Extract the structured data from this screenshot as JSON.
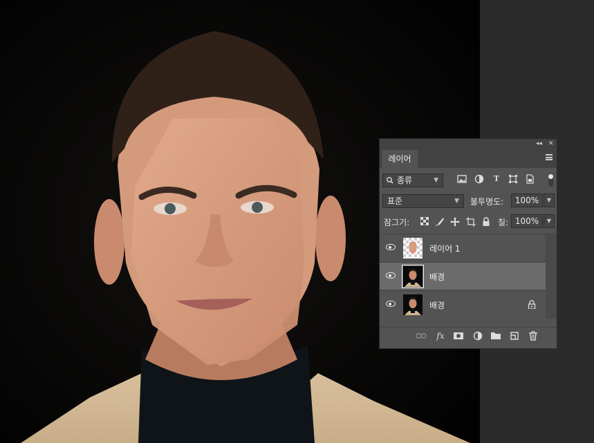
{
  "panel": {
    "collapse_label": "◂◂",
    "close_label": "✕",
    "tab_label": "레이어",
    "filter": {
      "search_icon": "search-icon",
      "kind_label": "종류",
      "icons": [
        "image-filter-icon",
        "adjustment-filter-icon",
        "type-filter-icon",
        "shape-filter-icon",
        "smart-object-filter-icon"
      ]
    },
    "blend_mode": "표준",
    "opacity_label": "불투명도:",
    "opacity_value": "100%",
    "lock_label": "잠그기:",
    "fill_label": "칠:",
    "fill_value": "100%",
    "layers": [
      {
        "name": "레이어 1",
        "visible": true,
        "selected": false,
        "locked": false
      },
      {
        "name": "배경",
        "visible": true,
        "selected": true,
        "locked": false
      },
      {
        "name": "배경",
        "visible": true,
        "selected": false,
        "locked": true
      }
    ],
    "bottom_icons": [
      "link-layers-icon",
      "fx-icon",
      "mask-icon",
      "adjustment-layer-icon",
      "folder-icon",
      "new-layer-icon",
      "trash-icon"
    ],
    "fx_label": "fx"
  }
}
